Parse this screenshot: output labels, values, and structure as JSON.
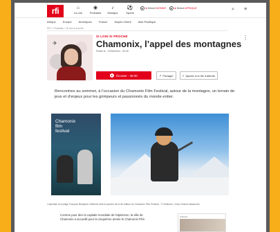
{
  "header": {
    "logo": "rfi",
    "nav": [
      {
        "label": "La une",
        "icon": "home-icon",
        "glyph": "⌂"
      },
      {
        "label": "Podcasts",
        "icon": "podcast-icon",
        "glyph": "◉"
      },
      {
        "label": "Musique",
        "icon": "music-icon",
        "glyph": "♪"
      },
      {
        "label": "Sports",
        "icon": "sports-icon",
        "glyph": "⚽"
      }
    ],
    "live": [
      {
        "label": "Direct",
        "channel": "MONDE"
      },
      {
        "label": "Direct",
        "channel": "AFRIQUE"
      }
    ],
    "search_glyph": "⌕",
    "menu_glyph": "≡"
  },
  "subnav": [
    "Afrique",
    "Europe",
    "Amériques",
    "France",
    "Moyen-Orient",
    "Asie-Pacifique"
  ],
  "breadcrumb": "RFI > Podcasts > Si loin si proche",
  "show": {
    "tag": "SI LOIN SI PROCHE",
    "title": "Chamonix, l’appel des montagnes",
    "published": "Publié le : 22/06/2024 - 00:30",
    "listen_label": "Écouter - 48:30",
    "share_label": "Partager",
    "playlist_label": "Ajouter à la file d'attente",
    "more_glyph": "⋮"
  },
  "description": "Rencontres au sommet, à l’occasion du Chamonix Film Festival, autour de la montagne, un terrain de jeux et d’enjeux pour les grimpeurs et passionnés du monde entier.",
  "poster": {
    "title_line1": "Chamonix",
    "title_line2": "film",
    "title_line3": "festival"
  },
  "caption": "L'alpiniste et prodige François Benjamin Vieillnine était le parrain de la 5e édition du Chamonix Film Festival · © Vieillnine / Jean-Charles Bassenne",
  "body": "Comme pour dire la capitale mondiale de l'alpinisme, la ville de Chamonix a accueilli pour la cinquième année le Chamonix Film",
  "ad": {
    "label": "Publicité"
  },
  "colors": {
    "brand": "#e2001a",
    "background": "#f7ae19"
  }
}
